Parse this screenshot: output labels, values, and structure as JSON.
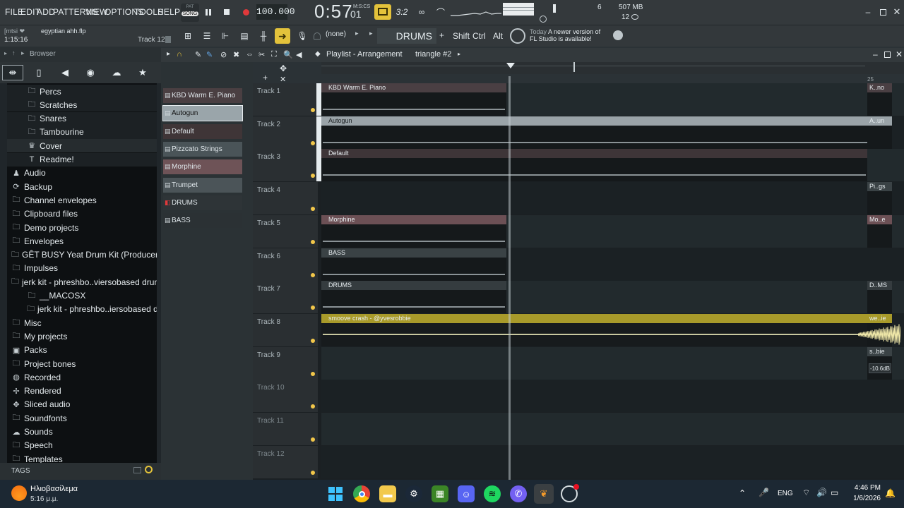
{
  "menu": [
    "FILE",
    "EDIT",
    "ADD",
    "PATTERNS",
    "VIEW",
    "OPTIONS",
    "TOOLS",
    "HELP"
  ],
  "transport": {
    "pat_label": "PAT",
    "song_label": "SONG",
    "tempo": "100.000",
    "time_main": "0:57",
    "time_sub": "01",
    "time_unit": "M:S:CS",
    "cpu_label": "507 MB",
    "poly": "12",
    "meter_val": "6"
  },
  "song": {
    "user": "[mtsi ❤",
    "filename": "egyptian ahh.flp",
    "position": "1:15:16",
    "track_label": "Track 12"
  },
  "toolbar2": {
    "snap": "(none)",
    "pattern": "DRUMS",
    "mods": [
      "Shift",
      "Ctrl",
      "Alt"
    ],
    "news_title": "Today",
    "news_body": "A newer version of FL Studio is available!"
  },
  "browser": {
    "title": "Browser",
    "tags_label": "TAGS",
    "items": [
      {
        "label": "Percs",
        "icon": "folder-icon",
        "indent": 1
      },
      {
        "label": "Scratches",
        "icon": "folder-icon",
        "indent": 1
      },
      {
        "label": "Snares",
        "icon": "folder-icon",
        "indent": 1
      },
      {
        "label": "Tambourine",
        "icon": "folder-icon",
        "indent": 1
      },
      {
        "label": "Cover",
        "icon": "image-icon",
        "indent": 1
      },
      {
        "label": "Readme!",
        "icon": "text-icon",
        "indent": 1
      },
      {
        "label": "Audio",
        "icon": "person-icon",
        "indent": 0
      },
      {
        "label": "Backup",
        "icon": "folder-sync-icon",
        "indent": 0
      },
      {
        "label": "Channel envelopes",
        "icon": "folder-icon",
        "indent": 0
      },
      {
        "label": "Clipboard files",
        "icon": "folder-icon",
        "indent": 0
      },
      {
        "label": "Demo projects",
        "icon": "folder-icon",
        "indent": 0
      },
      {
        "label": "Envelopes",
        "icon": "folder-icon",
        "indent": 0
      },
      {
        "label": "GÊT BUSY Yeat Drum Kit (Producergrind)",
        "icon": "folder-icon",
        "indent": 0
      },
      {
        "label": "Impulses",
        "icon": "folder-icon",
        "indent": 0
      },
      {
        "label": "jerk kit - phreshbo..viersobased drum kit",
        "icon": "folder-icon",
        "indent": 0
      },
      {
        "label": "__MACOSX",
        "icon": "folder-icon",
        "indent": 1
      },
      {
        "label": "jerk kit - phreshbo..iersobased drum kit",
        "icon": "folder-icon",
        "indent": 1
      },
      {
        "label": "Misc",
        "icon": "folder-icon",
        "indent": 0
      },
      {
        "label": "My projects",
        "icon": "folder-icon",
        "indent": 0
      },
      {
        "label": "Packs",
        "icon": "packs-icon",
        "indent": 0
      },
      {
        "label": "Project bones",
        "icon": "folder-icon",
        "indent": 0
      },
      {
        "label": "Recorded",
        "icon": "record-icon",
        "indent": 0
      },
      {
        "label": "Rendered",
        "icon": "render-icon",
        "indent": 0
      },
      {
        "label": "Sliced audio",
        "icon": "slice-icon",
        "indent": 0
      },
      {
        "label": "Soundfonts",
        "icon": "folder-icon",
        "indent": 0
      },
      {
        "label": "Sounds",
        "icon": "cloud-icon",
        "indent": 0
      },
      {
        "label": "Speech",
        "icon": "folder-icon",
        "indent": 0
      },
      {
        "label": "Templates",
        "icon": "folder-icon",
        "indent": 0
      }
    ]
  },
  "patterns": [
    {
      "label": "KBD Warm E. Piano",
      "color": "#4a3f42"
    },
    {
      "label": "Autogun",
      "color": "#9aa5aa"
    },
    {
      "label": "Default",
      "color": "#3f3537"
    },
    {
      "label": "Pizzcato Strings",
      "color": "#4a5458"
    },
    {
      "label": "Morphine",
      "color": "#6e5357"
    },
    {
      "label": "Trumpet",
      "color": "#4b5458"
    },
    {
      "label": "DRUMS",
      "color": "#2e3437"
    },
    {
      "label": "BASS",
      "color": "#2b3134"
    }
  ],
  "playlist": {
    "title": "Playlist - Arrangement",
    "pattern_ref": "triangle #2",
    "ruler_mark": "25",
    "tracks": [
      {
        "label": "Track 1",
        "clip": "KBD Warm E. Piano",
        "color": "#4a3f43",
        "end_clip": "K..no"
      },
      {
        "label": "Track 2",
        "clip": "Autogun",
        "color": "#9aa3a8",
        "end_clip": "A..un"
      },
      {
        "label": "Track 3",
        "clip": "Default",
        "color": "#3e3538",
        "end_clip": ""
      },
      {
        "label": "Track 4",
        "clip": "",
        "color": "",
        "end_clip": "Pi..gs"
      },
      {
        "label": "Track 5",
        "clip": "Morphine",
        "color": "#6c5055",
        "end_clip": "Mo..e"
      },
      {
        "label": "Track 6",
        "clip": "BASS",
        "color": "#3a4245",
        "end_clip": ""
      },
      {
        "label": "Track 7",
        "clip": "DRUMS",
        "color": "#353c3f",
        "end_clip": "D..MS"
      },
      {
        "label": "Track 8",
        "clip": "smoove crash - @yvesrobbie",
        "color": "#a89a2a",
        "end_clip": "we..ie"
      },
      {
        "label": "Track 9",
        "clip": "",
        "color": "",
        "end_clip": "s..bie"
      },
      {
        "label": "Track 10",
        "clip": "",
        "color": "",
        "end_clip": ""
      },
      {
        "label": "Track 11",
        "clip": "",
        "color": "",
        "end_clip": ""
      },
      {
        "label": "Track 12",
        "clip": "",
        "color": "",
        "end_clip": ""
      }
    ],
    "db_label": "-10.6dB"
  },
  "taskbar": {
    "weather": "Ηλιοβασίλεμα",
    "weather_time": "5:16 μ.μ.",
    "lang": "ENG",
    "clock_time": "4:46 PM",
    "clock_date": "1/6/2026"
  }
}
